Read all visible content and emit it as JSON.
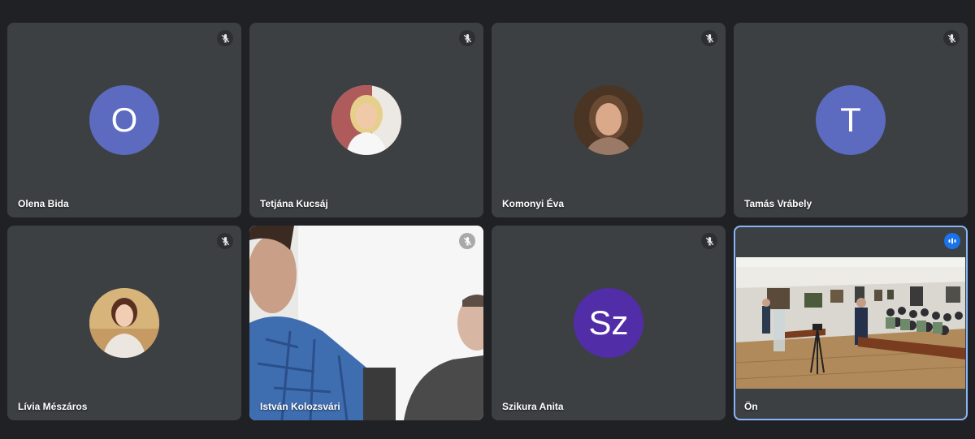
{
  "meeting": {
    "participants": [
      {
        "name": "Olena Bida",
        "initial": "O",
        "avatar_color": "#5c6bc0",
        "muted": true
      },
      {
        "name": "Tetjána Kucsáj",
        "avatar": "photo-portrait",
        "muted": true
      },
      {
        "name": "Komonyi Éva",
        "avatar": "photo-portrait",
        "muted": true
      },
      {
        "name": "Tamás Vrábely",
        "initial": "T",
        "avatar_color": "#5c6bc0",
        "muted": true
      },
      {
        "name": "Lívia Mészáros",
        "avatar": "photo-portrait",
        "muted": true
      },
      {
        "name": "István Kolozsvári",
        "video": "camera-feed",
        "muted": true
      },
      {
        "name": "Szikura Anita",
        "initial": "Sz",
        "avatar_color": "#512da8",
        "muted": true
      },
      {
        "name": "Ön",
        "video": "room-camera-feed",
        "speaking": true
      }
    ]
  },
  "icons": {
    "mic_off": "mic-off-icon",
    "speaking": "audio-level-icon"
  },
  "colors": {
    "background": "#202124",
    "tile": "#3c4043",
    "active_border": "#8ab4f8",
    "speaking_badge": "#1a73e8"
  }
}
